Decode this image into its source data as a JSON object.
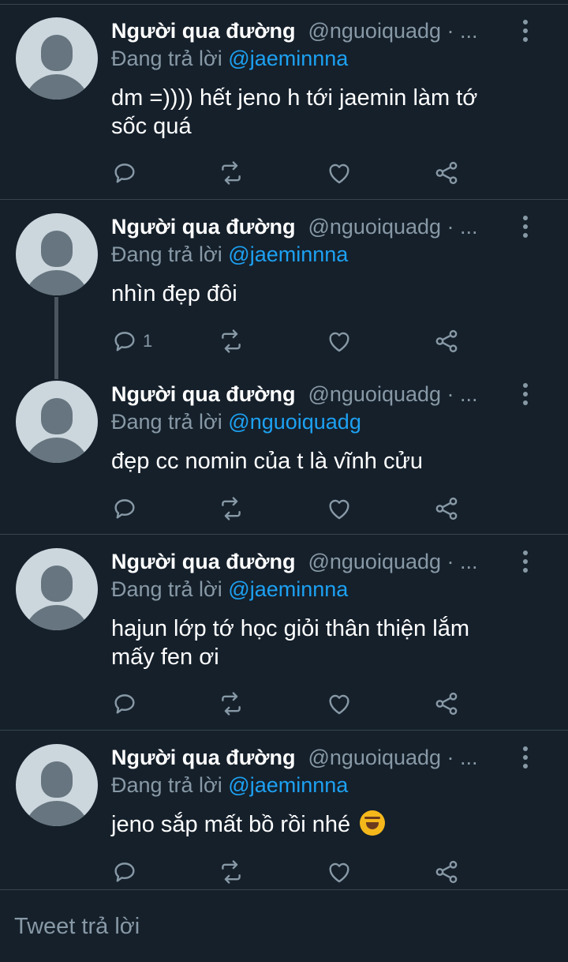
{
  "tweets": [
    {
      "name": "Người qua đường",
      "handle": "@nguoiquadg · ...",
      "replying_prefix": "Đang trả lời",
      "replying_to": "@jaeminnna",
      "text_lines": [
        "dm =)))) hết jeno h tới jaemin làm tớ",
        "sốc quá"
      ],
      "reply_count": ""
    },
    {
      "name": "Người qua đường",
      "handle": "@nguoiquadg · ...",
      "replying_prefix": "Đang trả lời",
      "replying_to": "@jaeminnna",
      "text_lines": [
        "nhìn đẹp đôi"
      ],
      "reply_count": "1"
    },
    {
      "name": "Người qua đường",
      "handle": "@nguoiquadg · ...",
      "replying_prefix": "Đang trả lời",
      "replying_to": "@nguoiquadg",
      "text_lines": [
        "đẹp cc nomin của t là vĩnh cửu"
      ],
      "reply_count": ""
    },
    {
      "name": "Người qua đường",
      "handle": "@nguoiquadg · ...",
      "replying_prefix": "Đang trả lời",
      "replying_to": "@jaeminnna",
      "text_lines": [
        "hajun lớp tớ học giỏi thân thiện lắm",
        "mấy fen ơi"
      ],
      "reply_count": ""
    },
    {
      "name": "Người qua đường",
      "handle": "@nguoiquadg · ...",
      "replying_prefix": "Đang trả lời",
      "replying_to": "@jaeminnna",
      "text_lines": [
        "jeno sắp mất bồ rồi nhé"
      ],
      "emoji": "rolling-on-floor-laughing",
      "reply_count": ""
    }
  ],
  "icons": [
    "reply-icon",
    "retweet-icon",
    "like-icon",
    "share-icon",
    "more-icon"
  ],
  "reply_bar": {
    "placeholder": "Tweet trả lời"
  },
  "colors": {
    "background": "#15202b",
    "divider": "#38444d",
    "secondary_text": "#8899a6",
    "mention": "#1da1f2",
    "avatar_bg": "#ccd6dd",
    "avatar_fg": "#66757f"
  }
}
